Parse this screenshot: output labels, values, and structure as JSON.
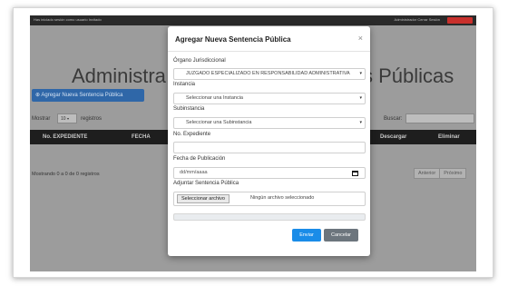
{
  "topbar": {
    "left_text": "Has iniciado sesión como usuario Invitado",
    "right_text": "Administrador   Cerrar Sesión"
  },
  "background": {
    "title_left": "Administra",
    "title_right": "s Públicas",
    "add_button": "Agregar Nueva Sentencia Pública",
    "show_label": "Mostrar",
    "show_value": "10",
    "records_label": "registros",
    "search_label": "Buscar:",
    "columns": [
      "No. EXPEDIENTE",
      "FECHA",
      "Descargar",
      "Eliminar"
    ],
    "info_text": "Mostrando 0 a 0 de 0 registros",
    "pager": [
      "Anterior",
      "Próximo"
    ]
  },
  "modal": {
    "title": "Agregar Nueva Sentencia Pública",
    "close": "×",
    "organo_label": "Órgano Jurisdiccional",
    "organo_value": "JUZGADO ESPECIALIZADO EN RESPONSABILIDAD ADMINISTRATIVA",
    "instancia_label": "Instancia",
    "instancia_value": "Seleccionar una Instancia",
    "subinstancia_label": "Subinstancia",
    "subinstancia_value": "Seleccionar una Subinstancia",
    "expediente_label": "No. Expediente",
    "expediente_value": "",
    "fecha_label": "Fecha de Publicación",
    "fecha_placeholder": "dd/mm/aaaa",
    "adjuntar_label": "Adjuntar Sentencia Pública",
    "file_button": "Seleccionar archivo",
    "file_status": "Ningún archivo seleccionado",
    "progress_percent": 0,
    "save_label": "Enviar",
    "cancel_label": "Cancelar"
  },
  "colors": {
    "primary": "#1a8ce8",
    "secondary": "#6c757d",
    "table_head": "#1e1e1e"
  }
}
